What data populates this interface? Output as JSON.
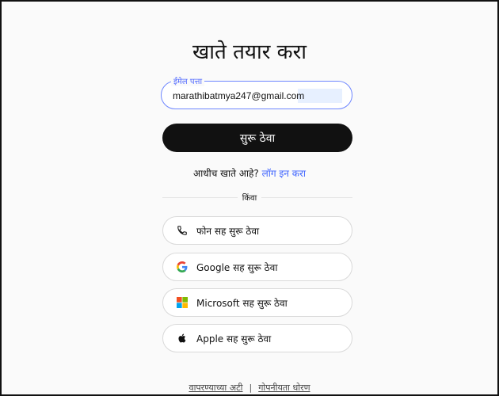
{
  "page": {
    "title": "खाते तयार करा"
  },
  "email": {
    "label": "ईमेल पत्ता",
    "value": "marathibatmya247@gmail.com"
  },
  "continue_label": "सुरू ठेवा",
  "login": {
    "prompt": "आधीच खाते आहे?",
    "link": "लॉग इन करा"
  },
  "divider": "किंवा",
  "social": [
    {
      "label": "फोन सह सुरू ठेवा",
      "icon": "phone-icon"
    },
    {
      "label": "Google सह सुरू ठेवा",
      "icon": "google-icon"
    },
    {
      "label": "Microsoft सह सुरू ठेवा",
      "icon": "microsoft-icon"
    },
    {
      "label": "Apple सह सुरू ठेवा",
      "icon": "apple-icon"
    }
  ],
  "footer": {
    "terms": "वापरण्याच्या अटी",
    "separator": "|",
    "privacy": "गोपनीयता धोरण"
  },
  "colors": {
    "accent": "#3d63ff",
    "button_dark": "#111111",
    "input_border": "#6f87ff"
  }
}
